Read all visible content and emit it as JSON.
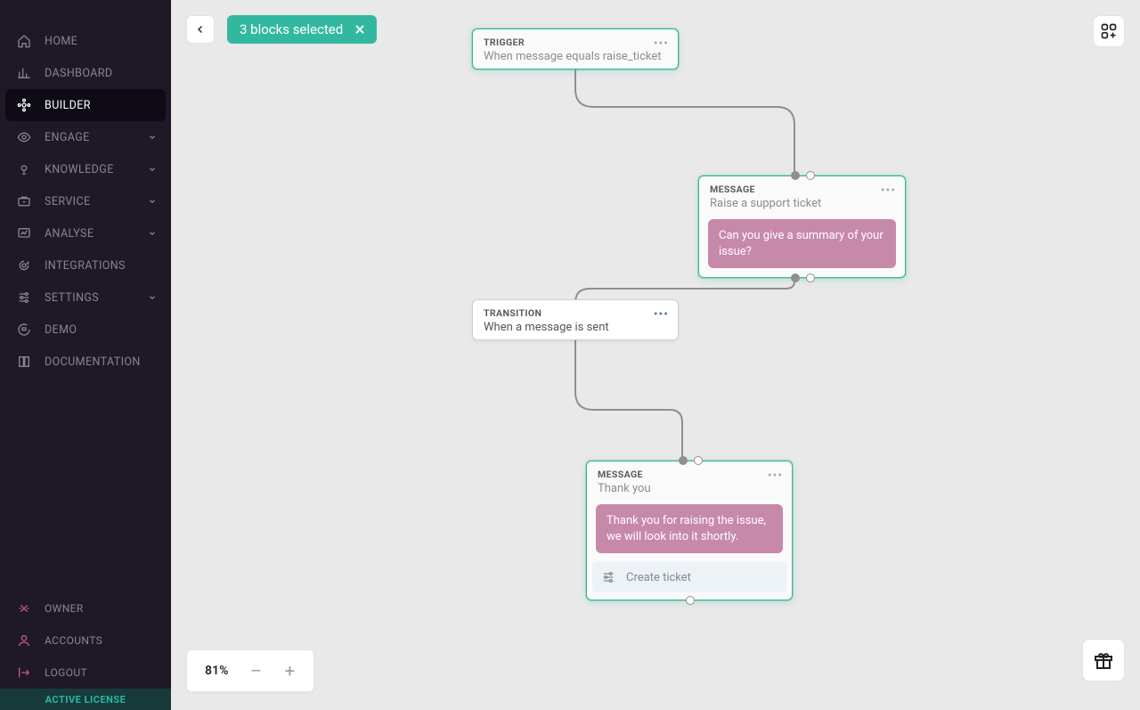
{
  "sidebar": {
    "items": [
      {
        "label": "HOME"
      },
      {
        "label": "DASHBOARD"
      },
      {
        "label": "BUILDER"
      },
      {
        "label": "ENGAGE"
      },
      {
        "label": "KNOWLEDGE"
      },
      {
        "label": "SERVICE"
      },
      {
        "label": "ANALYSE"
      },
      {
        "label": "INTEGRATIONS"
      },
      {
        "label": "SETTINGS"
      },
      {
        "label": "DEMO"
      },
      {
        "label": "DOCUMENTATION"
      }
    ],
    "bottom": [
      {
        "label": "OWNER"
      },
      {
        "label": "ACCOUNTS"
      },
      {
        "label": "LOGOUT"
      }
    ],
    "license": "ACTIVE LICENSE"
  },
  "topbar": {
    "selection_text": "3 blocks selected"
  },
  "zoom": {
    "value": "81%",
    "minus": "–",
    "plus": "+"
  },
  "nodes": {
    "trigger": {
      "type": "TRIGGER",
      "title": "When message equals raise_ticket"
    },
    "message1": {
      "type": "MESSAGE",
      "title": "Raise a support ticket",
      "bubble": "Can you give a summary of your issue?"
    },
    "transition": {
      "type": "TRANSITION",
      "title": "When a message is sent"
    },
    "message2": {
      "type": "MESSAGE",
      "title": "Thank you",
      "bubble": "Thank you for raising the issue, we will look into it shortly.",
      "action": "Create ticket"
    }
  }
}
